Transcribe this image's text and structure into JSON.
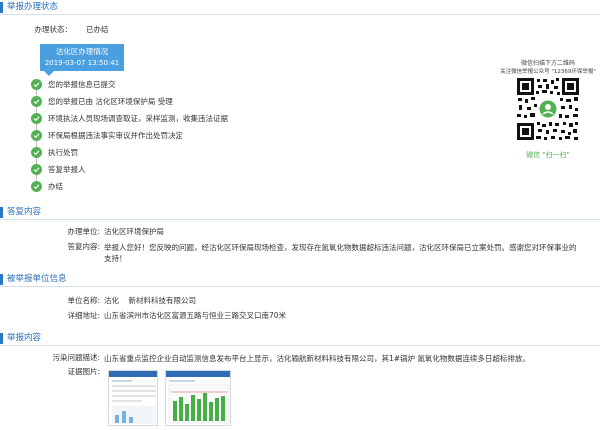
{
  "status_section": {
    "title": "举报办理状态",
    "status_label": "办理状态：",
    "status_value": "已办结",
    "badge_title": "沽化区办理情况",
    "badge_time": "2019-03-07 13:50:41",
    "steps": [
      "您的举报信息已提交",
      "您的举报已由 沽化区环境保护局 受理",
      "环境执法人员现场调查取证，采样监测，收集违法证据",
      "环保局根据违法事实审议并作出处罚决定",
      "执行处罚",
      "答复举报人",
      "办结"
    ],
    "qr_caption_1": "微信扫描下方二维码",
    "qr_caption_2": "关注微信举报公众号 \"12369环保举报\"",
    "qr_scan": "微信 \"扫一扫\""
  },
  "reply_section": {
    "title": "答复内容",
    "unit_label": "办理单位:",
    "unit_value": "沽化区环境保护局",
    "content_label": "答复内容:",
    "content_value": "举报人您好！您反映的问题，经沽化区环保局现场检查，发现存在氮氧化物数据超标违法问题，沽化区环保局已立案处罚。感谢您对环保事业的支持！"
  },
  "reported_section": {
    "title": "被举报单位信息",
    "name_label": "单位名称:",
    "name_value": "沽化    新材料科技有限公司",
    "addr_label": "详细地址:",
    "addr_value": "山东省滨州市沽化区富源五路与恒业三路交叉口南70米"
  },
  "report_section": {
    "title": "举报内容",
    "desc_label": "污染问题描述:",
    "desc_value": "山东省重点监控企业自动监测信息发布平台上显示，沽化输航新材料科技有限公司，其1#锅炉 氮氧化物数据连续多日超标排放。",
    "evidence_label": "证据图片:"
  },
  "colors": {
    "accent": "#2b78c5",
    "badge": "#4a9fe0",
    "done": "#52b152"
  }
}
